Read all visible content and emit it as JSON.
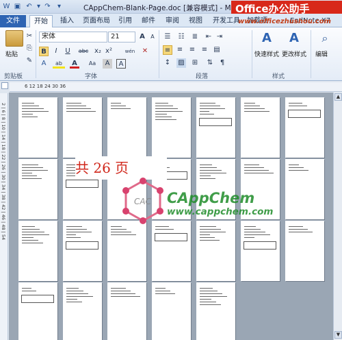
{
  "titlebar": {
    "title": "CAppChem-Blank-Page.doc [兼容模式] - Microsoft Word"
  },
  "brand": {
    "name": "Office办公助手",
    "url": "www.officezhushou.com"
  },
  "tabs": [
    {
      "label": "文件"
    },
    {
      "label": "开始"
    },
    {
      "label": "插入"
    },
    {
      "label": "页面布局"
    },
    {
      "label": "引用"
    },
    {
      "label": "邮件"
    },
    {
      "label": "审阅"
    },
    {
      "label": "视图"
    },
    {
      "label": "开发工具"
    },
    {
      "label": "加载项"
    },
    {
      "label": "EndNote X7"
    }
  ],
  "ribbon": {
    "paste_label": "粘贴",
    "clipboard_group": "剪贴板",
    "font_name": "宋体",
    "font_size": "21",
    "font_group": "字体",
    "paragraph_group": "段落",
    "quick_styles_label": "快速样式",
    "change_styles_label": "更改样式",
    "styles_group": "样式",
    "edit_label": "编辑",
    "bold_label": "B",
    "italic_label": "I",
    "underline_label": "U",
    "strike_label": "abc",
    "subscript_label": "x₂",
    "superscript_label": "x²",
    "highlight_label": "ab",
    "fontcolor_label": "A",
    "charscale_label": "Aa",
    "grow_label": "A",
    "shrink_label": "A",
    "clear_label": "A",
    "pinyin_label": "wén",
    "char_border_label": "A"
  },
  "ruler": {
    "ticks": "6 12 18 24 30 36",
    "vertical_ticks": "2 | 6 | 8 | 10 | 14 | 18 | 22 | 26 | 30 | 34 | 38 | 42 | 46 | 48 | 54"
  },
  "document": {
    "pages_label": "共  26  页",
    "watermark_name": "CAppChem",
    "watermark_url": "www.cappchem.com",
    "watermark_logo_text": "CAC"
  },
  "colors": {
    "file_tab": "#2e64b3",
    "brand_bg": "#d8281a",
    "watermark": "#1f8d2a",
    "pages_label": "#d0261a"
  }
}
